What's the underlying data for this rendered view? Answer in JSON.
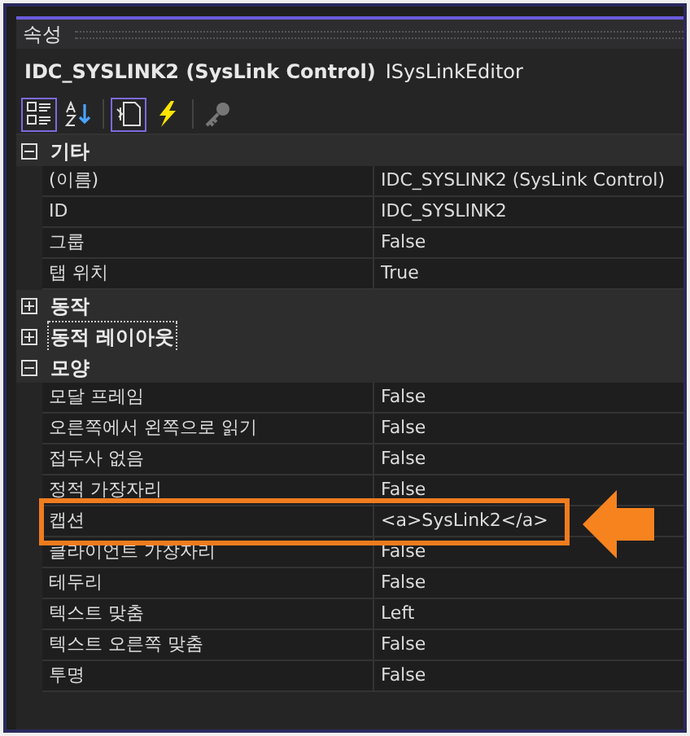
{
  "panel": {
    "title": "속성"
  },
  "object": {
    "name": "IDC_SYSLINK2 (SysLink Control)",
    "editor": "ISysLinkEditor"
  },
  "toolbar": [
    {
      "kind": "categorized",
      "selected": true
    },
    {
      "kind": "alphabetical",
      "selected": false
    },
    {
      "kind": "properties",
      "selected": true
    },
    {
      "kind": "events",
      "selected": false
    },
    {
      "kind": "key",
      "selected": false
    }
  ],
  "categories": [
    {
      "name": "기타",
      "expanded": true,
      "selected": false,
      "properties": [
        {
          "name": "(이름)",
          "value": "IDC_SYSLINK2 (SysLink Control)",
          "highlighted": false
        },
        {
          "name": "ID",
          "value": "IDC_SYSLINK2",
          "highlighted": false
        },
        {
          "name": "그룹",
          "value": "False",
          "highlighted": false
        },
        {
          "name": "탭 위치",
          "value": "True",
          "highlighted": false
        }
      ]
    },
    {
      "name": "동작",
      "expanded": false,
      "selected": false
    },
    {
      "name": "동적 레이아웃",
      "expanded": false,
      "selected": true
    },
    {
      "name": "모양",
      "expanded": true,
      "selected": false,
      "properties": [
        {
          "name": "모달 프레임",
          "value": "False",
          "highlighted": false
        },
        {
          "name": "오른쪽에서 왼쪽으로 읽기",
          "value": "False",
          "highlighted": false
        },
        {
          "name": "접두사 없음",
          "value": "False",
          "highlighted": false
        },
        {
          "name": "정적 가장자리",
          "value": "False",
          "highlighted": false
        },
        {
          "name": "캡션",
          "value": "<a>SysLink2</a>",
          "highlighted": true
        },
        {
          "name": "클라이언트 가장자리",
          "value": "False",
          "highlighted": false
        },
        {
          "name": "테두리",
          "value": "False",
          "highlighted": false
        },
        {
          "name": "텍스트 맞춤",
          "value": "Left",
          "highlighted": false
        },
        {
          "name": "텍스트 오른쪽 맞춤",
          "value": "False",
          "highlighted": false
        },
        {
          "name": "투명",
          "value": "False",
          "highlighted": false
        }
      ]
    }
  ]
}
